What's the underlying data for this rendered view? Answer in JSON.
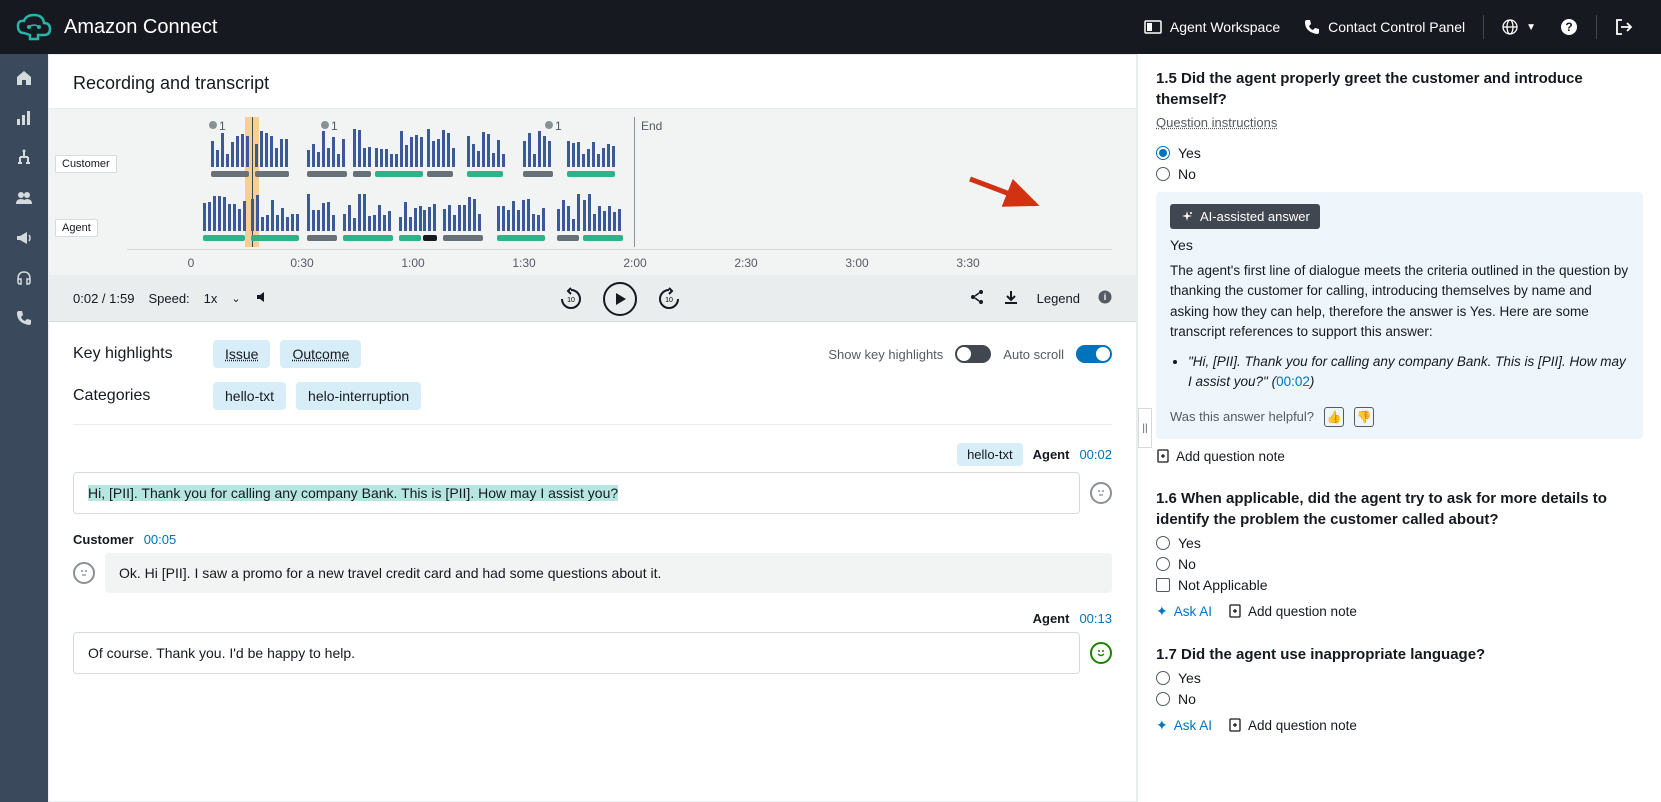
{
  "topbar": {
    "brand": "Amazon Connect",
    "agent_workspace": "Agent Workspace",
    "ccp": "Contact Control Panel"
  },
  "recording": {
    "title": "Recording and transcript",
    "lane_customer": "Customer",
    "lane_agent": "Agent",
    "end_label": "End",
    "markers": [
      "1",
      "1",
      "1"
    ],
    "axis": [
      "0",
      "0:30",
      "1:00",
      "1:30",
      "2:00",
      "2:30",
      "3:00",
      "3:30"
    ]
  },
  "player": {
    "position": "0:02 / 1:59",
    "speed_label": "Speed:",
    "speed_value": "1x",
    "legend": "Legend"
  },
  "highlights": {
    "section_label": "Key highlights",
    "issue_chip": "Issue",
    "outcome_chip": "Outcome",
    "show_label": "Show key highlights",
    "autoscroll_label": "Auto scroll",
    "categories_label": "Categories",
    "cat1": "hello-txt",
    "cat2": "helo-interruption"
  },
  "transcript": [
    {
      "tag": "hello-txt",
      "speaker": "Agent",
      "time": "00:02",
      "align": "right",
      "text": "Hi, [PII]. Thank you for calling any company Bank. This is [PII]. How may I assist you?",
      "highlight": true,
      "sentiment": "neutral"
    },
    {
      "speaker": "Customer",
      "time": "00:05",
      "align": "left",
      "text": "Ok. Hi [PII]. I saw a promo for a new travel credit card and had some questions about it.",
      "bg": "grey",
      "sentiment": "neutral"
    },
    {
      "speaker": "Agent",
      "time": "00:13",
      "align": "right",
      "text": "Of course. Thank you. I'd be happy to help.",
      "sentiment": "positive"
    }
  ],
  "questions": {
    "q15": {
      "title": "1.5 Did the agent properly greet the customer and introduce themself?",
      "instructions": "Question instructions",
      "opt_yes": "Yes",
      "opt_no": "No",
      "ai_badge": "AI-assisted answer",
      "ai_answer": "Yes",
      "ai_explanation": "The agent's first line of dialogue meets the criteria outlined in the question by thanking the customer for calling, introducing themselves by name and asking how they can help, therefore the answer is Yes. Here are some transcript references to support this answer:",
      "ai_quote": "\"Hi, [PII]. Thank you for calling any company Bank. This is [PII]. How may I assist you?\"",
      "ai_quote_ts": "00:02",
      "feedback_label": "Was this answer helpful?",
      "note_action": "Add question note"
    },
    "q16": {
      "title": "1.6 When applicable, did the agent try to ask for more details to identify the problem the customer called about?",
      "opt_yes": "Yes",
      "opt_no": "No",
      "opt_na": "Not Applicable",
      "ask_ai": "Ask AI",
      "note_action": "Add question note"
    },
    "q17": {
      "title": "1.7 Did the agent use inappropriate language?",
      "opt_yes": "Yes",
      "opt_no": "No",
      "ask_ai": "Ask AI",
      "note_action": "Add question note"
    }
  }
}
